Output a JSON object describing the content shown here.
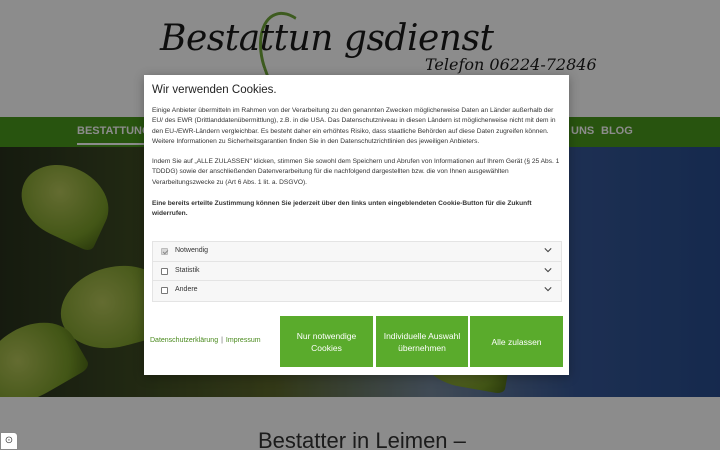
{
  "site": {
    "logo_text": "Bestattun gsdienst",
    "phone": "Telefon 06224-72846",
    "nav": {
      "first_visible": "BESTATTUNGS",
      "uns": "UNS",
      "blog": "BLOG"
    },
    "heading": "Bestatter in Leimen –"
  },
  "colors": {
    "brand_green": "#4a9a1d",
    "button_green": "#5aab2c",
    "link_green": "#4a8a1d"
  },
  "cookie_dialog": {
    "title": "Wir verwenden Cookies.",
    "paragraph_1": "Einige Anbieter übermitteln im Rahmen von der Verarbeitung zu den genannten Zwecken möglicherweise Daten an Länder außerhalb der EU/ des EWR (Drittlanddatenübermittlung), z.B. in die USA. Das Datenschutzniveau in diesen Ländern ist möglicherweise nicht mit dem in den EU-/EWR-Ländern vergleichbar. Es besteht daher ein erhöhtes Risiko, dass staatliche Behörden auf diese Daten zugreifen können. Weitere Informationen zu Sicherheitsgarantien finden Sie in den Datenschutzrichtlinien des jeweiligen Anbieters.",
    "paragraph_2": "Indem Sie auf „ALLE ZULASSEN\" klicken, stimmen Sie sowohl dem Speichern und Abrufen von Informationen auf Ihrem Gerät (§ 25 Abs. 1 TDDDG) sowie der anschließenden Datenverarbeitung für die nachfolgend dargestellten bzw. die von Ihnen ausgewählten Verarbeitungszwecke zu (Art 6 Abs. 1 lit. a. DSGVO).",
    "paragraph_3": "Eine bereits erteilte Zustimmung können Sie jederzeit über den links unten eingeblendeten Cookie-Button für die Zukunft widerrufen.",
    "categories": [
      {
        "label": "Notwendig",
        "checked": true,
        "disabled": true
      },
      {
        "label": "Statistik",
        "checked": false,
        "disabled": false
      },
      {
        "label": "Andere",
        "checked": false,
        "disabled": false
      }
    ],
    "links": {
      "privacy": "Datenschutzerklärung",
      "separator": "|",
      "imprint": "Impressum"
    },
    "buttons": {
      "necessary": "Nur notwendige Cookies",
      "individual": "Individuelle Auswahl übernehmen",
      "accept_all": "Alle zulassen"
    }
  },
  "icons": {
    "chevron": "chevron-down-icon",
    "cookie_button": "cookie-settings-icon"
  }
}
